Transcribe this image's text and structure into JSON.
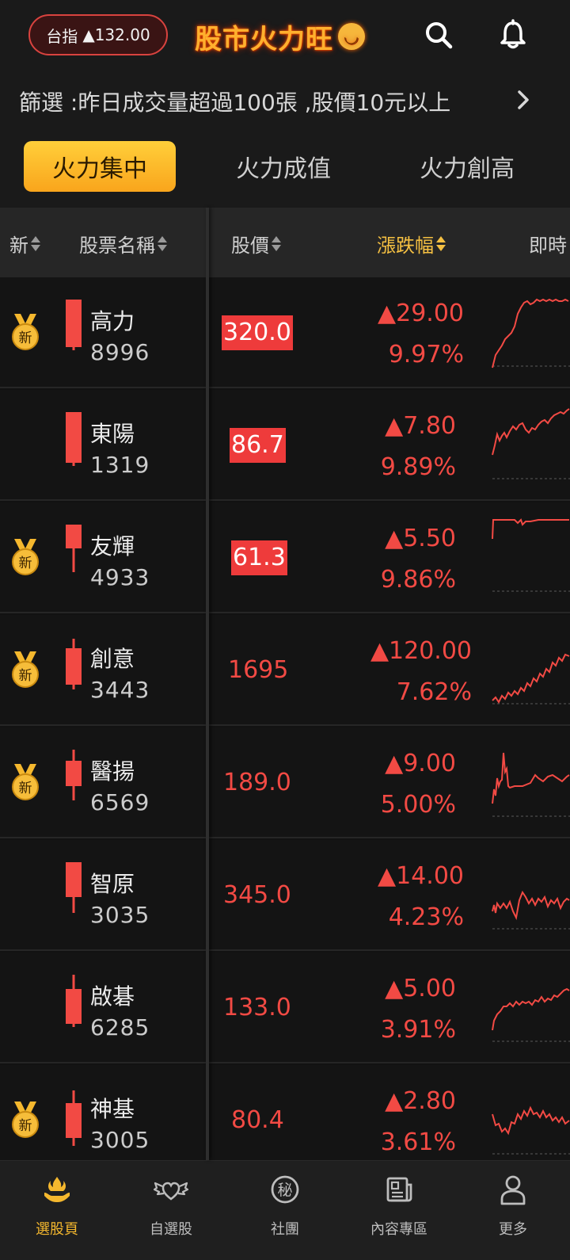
{
  "header": {
    "index_label": "台指",
    "index_change": "▲132.00",
    "brand_title": "股市火力旺",
    "icons": [
      "search-icon",
      "bell-icon"
    ]
  },
  "filter": {
    "text": "篩選 :昨日成交量超過100張 ,股價10元以上"
  },
  "tabs": [
    {
      "label": "火力集中",
      "active": true
    },
    {
      "label": "火力成值",
      "active": false
    },
    {
      "label": "火力創高",
      "active": false
    }
  ],
  "columns": {
    "new": "新",
    "name": "股票名稱",
    "price": "股價",
    "change": "漲跌幅",
    "realtime": "即時"
  },
  "medal_label": "新",
  "rows": [
    {
      "name": "高力",
      "code": "8996",
      "price": "320.0",
      "limit_up": true,
      "change": "▲29.00",
      "pct": "9.97%",
      "is_new": true
    },
    {
      "name": "東陽",
      "code": "1319",
      "price": "86.7",
      "limit_up": true,
      "change": "▲7.80",
      "pct": "9.89%",
      "is_new": false
    },
    {
      "name": "友輝",
      "code": "4933",
      "price": "61.3",
      "limit_up": true,
      "change": "▲5.50",
      "pct": "9.86%",
      "is_new": true
    },
    {
      "name": "創意",
      "code": "3443",
      "price": "1695",
      "limit_up": false,
      "change": "▲120.00",
      "pct": "7.62%",
      "is_new": true
    },
    {
      "name": "醫揚",
      "code": "6569",
      "price": "189.0",
      "limit_up": false,
      "change": "▲9.00",
      "pct": "5.00%",
      "is_new": true
    },
    {
      "name": "智原",
      "code": "3035",
      "price": "345.0",
      "limit_up": false,
      "change": "▲14.00",
      "pct": "4.23%",
      "is_new": false
    },
    {
      "name": "啟碁",
      "code": "6285",
      "price": "133.0",
      "limit_up": false,
      "change": "▲5.00",
      "pct": "3.91%",
      "is_new": false
    },
    {
      "name": "神基",
      "code": "3005",
      "price": "80.4",
      "limit_up": false,
      "change": "▲2.80",
      "pct": "3.61%",
      "is_new": true
    }
  ],
  "nav": [
    {
      "label": "選股頁",
      "icon": "hand-flame-icon",
      "active": true
    },
    {
      "label": "自選股",
      "icon": "winged-heart-icon",
      "active": false
    },
    {
      "label": "社團",
      "icon": "secret-badge-icon",
      "active": false
    },
    {
      "label": "內容專區",
      "icon": "newspaper-icon",
      "active": false
    },
    {
      "label": "更多",
      "icon": "person-icon",
      "active": false
    }
  ],
  "nav_badge_char": "秘",
  "colors": {
    "up_red": "#f24a44",
    "accent_gold": "#f5c042",
    "limit_bg": "#ee3b3b"
  }
}
